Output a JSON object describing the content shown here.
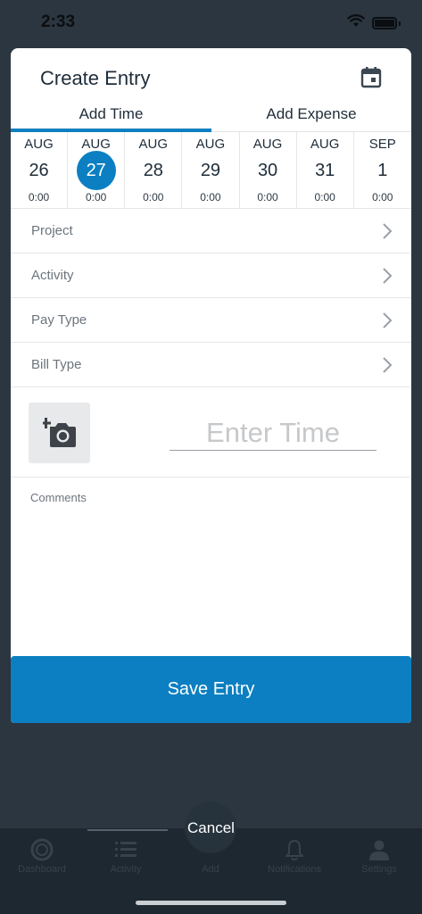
{
  "status_bar": {
    "time": "2:33"
  },
  "modal": {
    "title": "Create Entry",
    "tabs": [
      {
        "label": "Add Time",
        "active": true
      },
      {
        "label": "Add Expense",
        "active": false
      }
    ],
    "days": [
      {
        "month": "AUG",
        "day": "26",
        "hours": "0:00",
        "selected": false
      },
      {
        "month": "AUG",
        "day": "27",
        "hours": "0:00",
        "selected": true
      },
      {
        "month": "AUG",
        "day": "28",
        "hours": "0:00",
        "selected": false
      },
      {
        "month": "AUG",
        "day": "29",
        "hours": "0:00",
        "selected": false
      },
      {
        "month": "AUG",
        "day": "30",
        "hours": "0:00",
        "selected": false
      },
      {
        "month": "AUG",
        "day": "31",
        "hours": "0:00",
        "selected": false
      },
      {
        "month": "SEP",
        "day": "1",
        "hours": "0:00",
        "selected": false
      }
    ],
    "rows": [
      {
        "label": "Project"
      },
      {
        "label": "Activity"
      },
      {
        "label": "Pay Type"
      },
      {
        "label": "Bill Type"
      }
    ],
    "time_input": {
      "value": "",
      "placeholder": "Enter Time"
    },
    "comments": {
      "value": "",
      "placeholder": "Comments"
    },
    "save_label": "Save Entry"
  },
  "cancel_label": "Cancel",
  "bottom_nav": {
    "items": [
      {
        "label": "Dashboard",
        "icon": "dashboard-icon"
      },
      {
        "label": "Activity",
        "icon": "list-icon"
      },
      {
        "label": "Add",
        "icon": "add-icon"
      },
      {
        "label": "Notifications",
        "icon": "bell-icon"
      },
      {
        "label": "Settings",
        "icon": "person-icon"
      }
    ]
  },
  "colors": {
    "accent": "#0b7fc1",
    "overlay": "#2b3640"
  }
}
